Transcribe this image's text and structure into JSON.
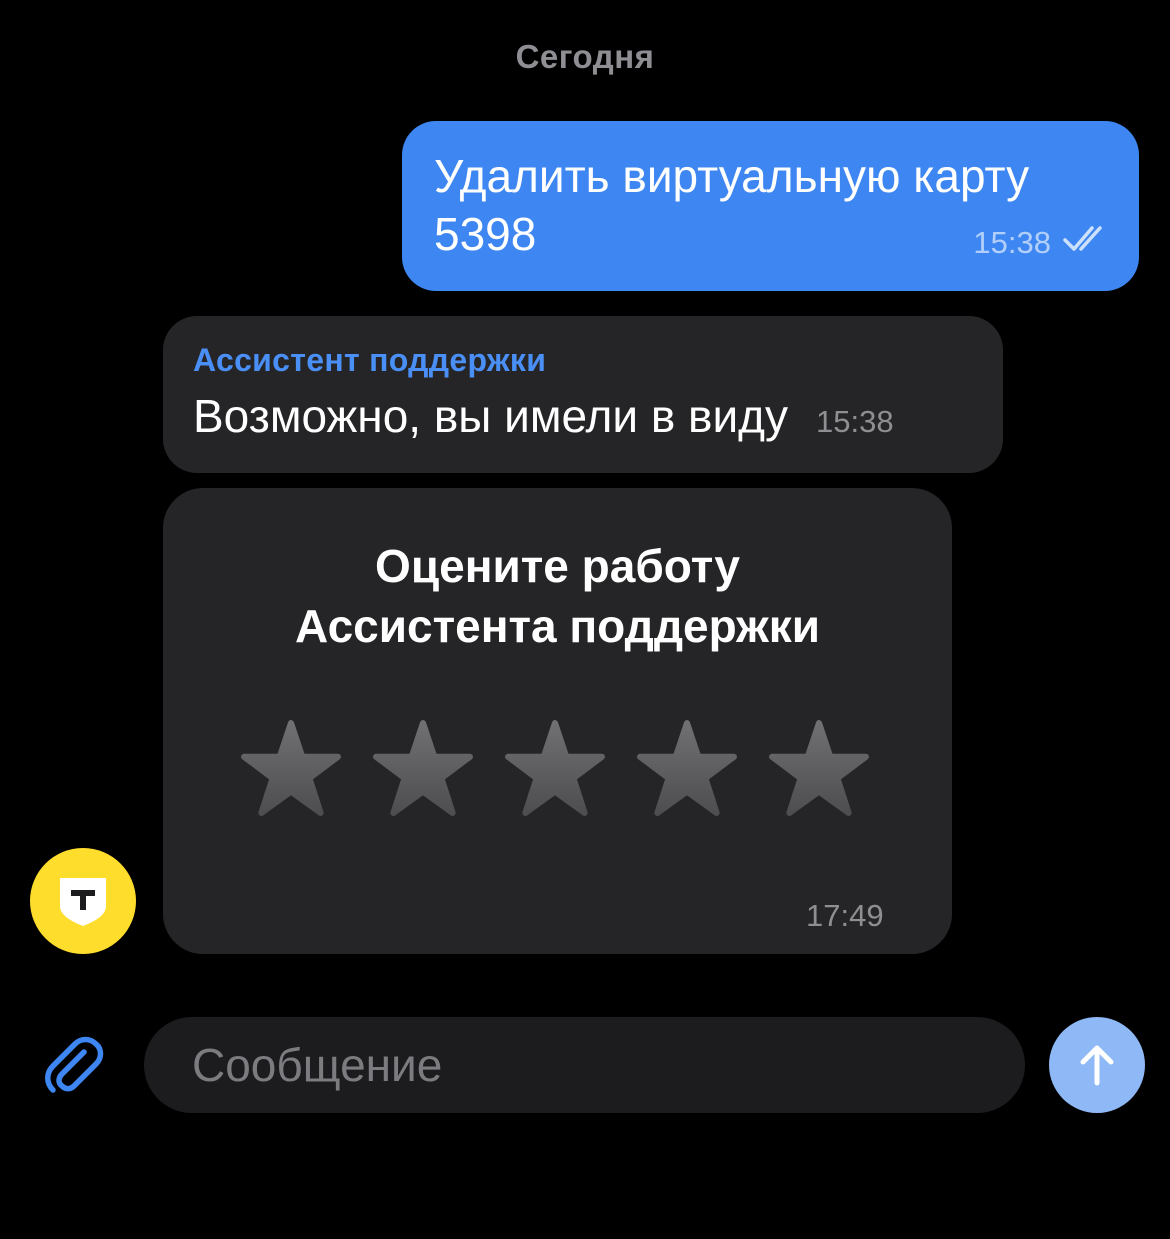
{
  "chat": {
    "date_separator": "Сегодня",
    "outgoing": {
      "text": "Удалить виртуальную карту 5398",
      "time": "15:38",
      "status_icon": "double-check-icon"
    },
    "incoming": {
      "sender": "Ассистент поддержки",
      "text": "Возможно, вы имели в виду",
      "time": "15:38"
    },
    "rating_card": {
      "title_line1": "Оцените работу",
      "title_line2": "Ассистента поддержки",
      "rating": 0,
      "max_rating": 5,
      "time": "17:49"
    },
    "avatar": {
      "icon": "bank-logo-icon",
      "color": "#ffdd2d"
    }
  },
  "composer": {
    "placeholder": "Сообщение",
    "value": "",
    "attach_icon": "paperclip-icon",
    "send_icon": "arrow-up-icon"
  },
  "colors": {
    "outgoing_bubble": "#3e87f2",
    "incoming_bubble": "#252527",
    "accent": "#4a8ff5",
    "send_button": "#8fb8f6"
  }
}
